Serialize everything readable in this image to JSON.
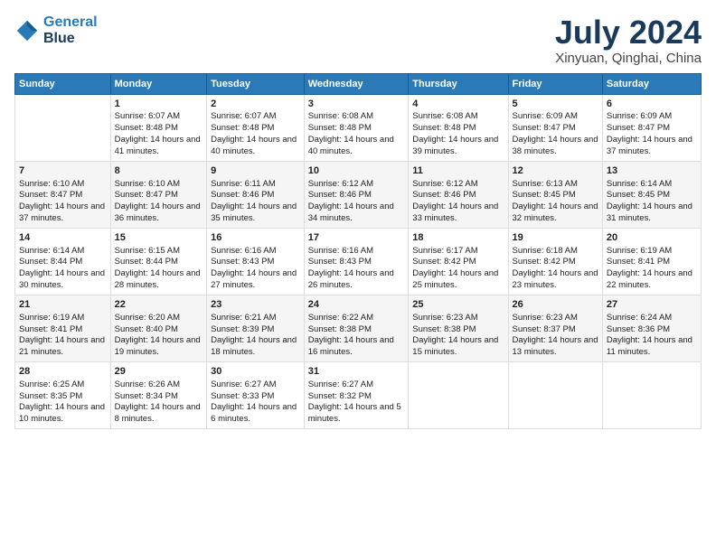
{
  "header": {
    "logo_line1": "General",
    "logo_line2": "Blue",
    "title": "July 2024",
    "subtitle": "Xinyuan, Qinghai, China"
  },
  "calendar": {
    "days_of_week": [
      "Sunday",
      "Monday",
      "Tuesday",
      "Wednesday",
      "Thursday",
      "Friday",
      "Saturday"
    ],
    "weeks": [
      [
        {
          "day": "",
          "sunrise": "",
          "sunset": "",
          "daylight": ""
        },
        {
          "day": "1",
          "sunrise": "Sunrise: 6:07 AM",
          "sunset": "Sunset: 8:48 PM",
          "daylight": "Daylight: 14 hours and 41 minutes."
        },
        {
          "day": "2",
          "sunrise": "Sunrise: 6:07 AM",
          "sunset": "Sunset: 8:48 PM",
          "daylight": "Daylight: 14 hours and 40 minutes."
        },
        {
          "day": "3",
          "sunrise": "Sunrise: 6:08 AM",
          "sunset": "Sunset: 8:48 PM",
          "daylight": "Daylight: 14 hours and 40 minutes."
        },
        {
          "day": "4",
          "sunrise": "Sunrise: 6:08 AM",
          "sunset": "Sunset: 8:48 PM",
          "daylight": "Daylight: 14 hours and 39 minutes."
        },
        {
          "day": "5",
          "sunrise": "Sunrise: 6:09 AM",
          "sunset": "Sunset: 8:47 PM",
          "daylight": "Daylight: 14 hours and 38 minutes."
        },
        {
          "day": "6",
          "sunrise": "Sunrise: 6:09 AM",
          "sunset": "Sunset: 8:47 PM",
          "daylight": "Daylight: 14 hours and 37 minutes."
        }
      ],
      [
        {
          "day": "7",
          "sunrise": "Sunrise: 6:10 AM",
          "sunset": "Sunset: 8:47 PM",
          "daylight": "Daylight: 14 hours and 37 minutes."
        },
        {
          "day": "8",
          "sunrise": "Sunrise: 6:10 AM",
          "sunset": "Sunset: 8:47 PM",
          "daylight": "Daylight: 14 hours and 36 minutes."
        },
        {
          "day": "9",
          "sunrise": "Sunrise: 6:11 AM",
          "sunset": "Sunset: 8:46 PM",
          "daylight": "Daylight: 14 hours and 35 minutes."
        },
        {
          "day": "10",
          "sunrise": "Sunrise: 6:12 AM",
          "sunset": "Sunset: 8:46 PM",
          "daylight": "Daylight: 14 hours and 34 minutes."
        },
        {
          "day": "11",
          "sunrise": "Sunrise: 6:12 AM",
          "sunset": "Sunset: 8:46 PM",
          "daylight": "Daylight: 14 hours and 33 minutes."
        },
        {
          "day": "12",
          "sunrise": "Sunrise: 6:13 AM",
          "sunset": "Sunset: 8:45 PM",
          "daylight": "Daylight: 14 hours and 32 minutes."
        },
        {
          "day": "13",
          "sunrise": "Sunrise: 6:14 AM",
          "sunset": "Sunset: 8:45 PM",
          "daylight": "Daylight: 14 hours and 31 minutes."
        }
      ],
      [
        {
          "day": "14",
          "sunrise": "Sunrise: 6:14 AM",
          "sunset": "Sunset: 8:44 PM",
          "daylight": "Daylight: 14 hours and 30 minutes."
        },
        {
          "day": "15",
          "sunrise": "Sunrise: 6:15 AM",
          "sunset": "Sunset: 8:44 PM",
          "daylight": "Daylight: 14 hours and 28 minutes."
        },
        {
          "day": "16",
          "sunrise": "Sunrise: 6:16 AM",
          "sunset": "Sunset: 8:43 PM",
          "daylight": "Daylight: 14 hours and 27 minutes."
        },
        {
          "day": "17",
          "sunrise": "Sunrise: 6:16 AM",
          "sunset": "Sunset: 8:43 PM",
          "daylight": "Daylight: 14 hours and 26 minutes."
        },
        {
          "day": "18",
          "sunrise": "Sunrise: 6:17 AM",
          "sunset": "Sunset: 8:42 PM",
          "daylight": "Daylight: 14 hours and 25 minutes."
        },
        {
          "day": "19",
          "sunrise": "Sunrise: 6:18 AM",
          "sunset": "Sunset: 8:42 PM",
          "daylight": "Daylight: 14 hours and 23 minutes."
        },
        {
          "day": "20",
          "sunrise": "Sunrise: 6:19 AM",
          "sunset": "Sunset: 8:41 PM",
          "daylight": "Daylight: 14 hours and 22 minutes."
        }
      ],
      [
        {
          "day": "21",
          "sunrise": "Sunrise: 6:19 AM",
          "sunset": "Sunset: 8:41 PM",
          "daylight": "Daylight: 14 hours and 21 minutes."
        },
        {
          "day": "22",
          "sunrise": "Sunrise: 6:20 AM",
          "sunset": "Sunset: 8:40 PM",
          "daylight": "Daylight: 14 hours and 19 minutes."
        },
        {
          "day": "23",
          "sunrise": "Sunrise: 6:21 AM",
          "sunset": "Sunset: 8:39 PM",
          "daylight": "Daylight: 14 hours and 18 minutes."
        },
        {
          "day": "24",
          "sunrise": "Sunrise: 6:22 AM",
          "sunset": "Sunset: 8:38 PM",
          "daylight": "Daylight: 14 hours and 16 minutes."
        },
        {
          "day": "25",
          "sunrise": "Sunrise: 6:23 AM",
          "sunset": "Sunset: 8:38 PM",
          "daylight": "Daylight: 14 hours and 15 minutes."
        },
        {
          "day": "26",
          "sunrise": "Sunrise: 6:23 AM",
          "sunset": "Sunset: 8:37 PM",
          "daylight": "Daylight: 14 hours and 13 minutes."
        },
        {
          "day": "27",
          "sunrise": "Sunrise: 6:24 AM",
          "sunset": "Sunset: 8:36 PM",
          "daylight": "Daylight: 14 hours and 11 minutes."
        }
      ],
      [
        {
          "day": "28",
          "sunrise": "Sunrise: 6:25 AM",
          "sunset": "Sunset: 8:35 PM",
          "daylight": "Daylight: 14 hours and 10 minutes."
        },
        {
          "day": "29",
          "sunrise": "Sunrise: 6:26 AM",
          "sunset": "Sunset: 8:34 PM",
          "daylight": "Daylight: 14 hours and 8 minutes."
        },
        {
          "day": "30",
          "sunrise": "Sunrise: 6:27 AM",
          "sunset": "Sunset: 8:33 PM",
          "daylight": "Daylight: 14 hours and 6 minutes."
        },
        {
          "day": "31",
          "sunrise": "Sunrise: 6:27 AM",
          "sunset": "Sunset: 8:32 PM",
          "daylight": "Daylight: 14 hours and 5 minutes."
        },
        {
          "day": "",
          "sunrise": "",
          "sunset": "",
          "daylight": ""
        },
        {
          "day": "",
          "sunrise": "",
          "sunset": "",
          "daylight": ""
        },
        {
          "day": "",
          "sunrise": "",
          "sunset": "",
          "daylight": ""
        }
      ]
    ]
  }
}
